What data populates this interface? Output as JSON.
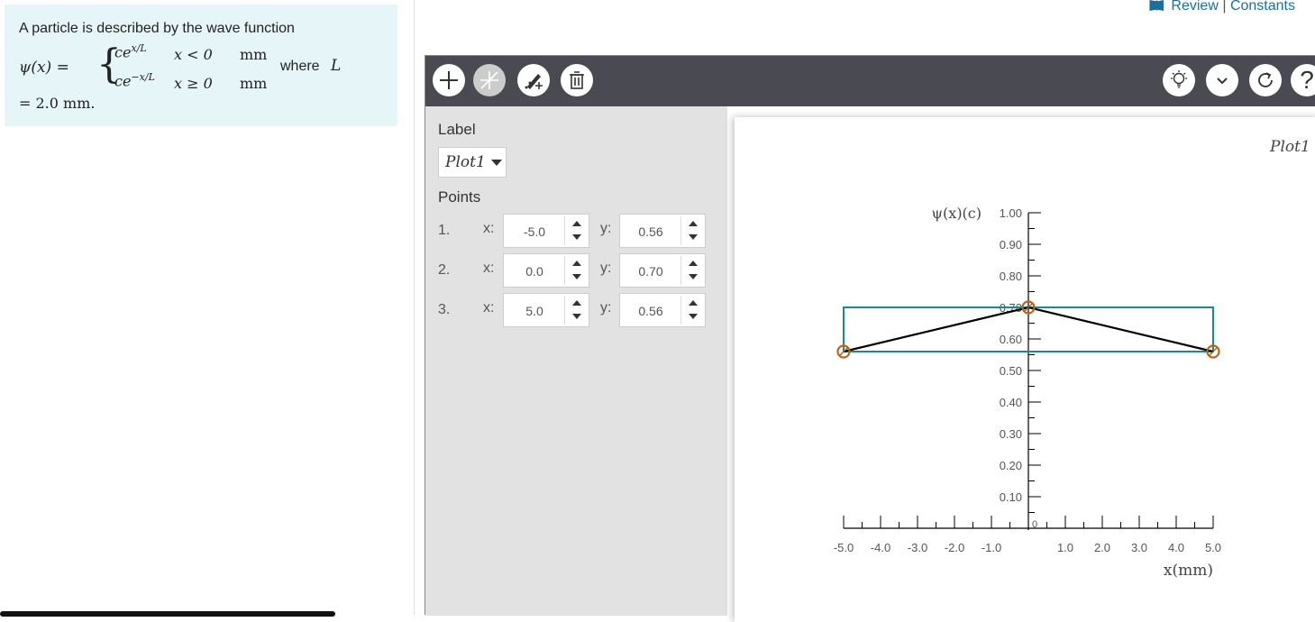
{
  "problem": {
    "intro": "A particle is described by the wave function",
    "psi": "ψ(x) =",
    "row1_expr": "ce",
    "row1_exp": "x/L",
    "row1_cond": "x < 0",
    "row1_unit": "mm",
    "row2_expr": "ce",
    "row2_exp": "−x/L",
    "row2_cond": "x ≥ 0",
    "row2_unit": "mm",
    "where": "where",
    "L_symbol": "L",
    "L_value": "= 2.0 mm."
  },
  "links": {
    "review": "Review",
    "separator": "|",
    "constants": "Constants"
  },
  "toolbar": {
    "left_icons": [
      "plus-icon",
      "line-icon",
      "add-point-icon",
      "trash-icon"
    ],
    "right_icons": [
      "lightbulb-icon",
      "chevron-down-icon",
      "reset-icon",
      "help-icon"
    ],
    "help_glyph": "?"
  },
  "sidepanel": {
    "label_heading": "Label",
    "selected_plot": "Plot1",
    "points_heading": "Points",
    "x_label": "x:",
    "y_label": "y:",
    "points": [
      {
        "num": "1.",
        "x": "-5.0",
        "y": "0.56"
      },
      {
        "num": "2.",
        "x": "0.0",
        "y": "0.70"
      },
      {
        "num": "3.",
        "x": "5.0",
        "y": "0.56"
      }
    ]
  },
  "chart_data": {
    "type": "line",
    "series": [
      {
        "name": "Plot1",
        "x": [
          -5.0,
          0.0,
          5.0
        ],
        "y": [
          0.56,
          0.7,
          0.56
        ]
      }
    ],
    "xlabel": "x(mm)",
    "ylabel": "ψ(x)(c)",
    "xlim": [
      -5.0,
      5.0
    ],
    "ylim": [
      0,
      1.0
    ],
    "x_ticks": [
      "-5.0",
      "-4.0",
      "-3.0",
      "-2.0",
      "-1.0",
      "1.0",
      "2.0",
      "3.0",
      "4.0",
      "5.0"
    ],
    "y_ticks": [
      "0.10",
      "0.20",
      "0.30",
      "0.40",
      "0.50",
      "0.60",
      "0.70",
      "0.80",
      "0.90",
      "1.00"
    ],
    "origin_label": "0",
    "bounding_box": {
      "x_min": -5.0,
      "x_max": 5.0,
      "y_min": 0.56,
      "y_max": 0.7
    },
    "line_color": "#000000",
    "box_color": "#1a8a8a",
    "point_color": "#b5651d"
  }
}
